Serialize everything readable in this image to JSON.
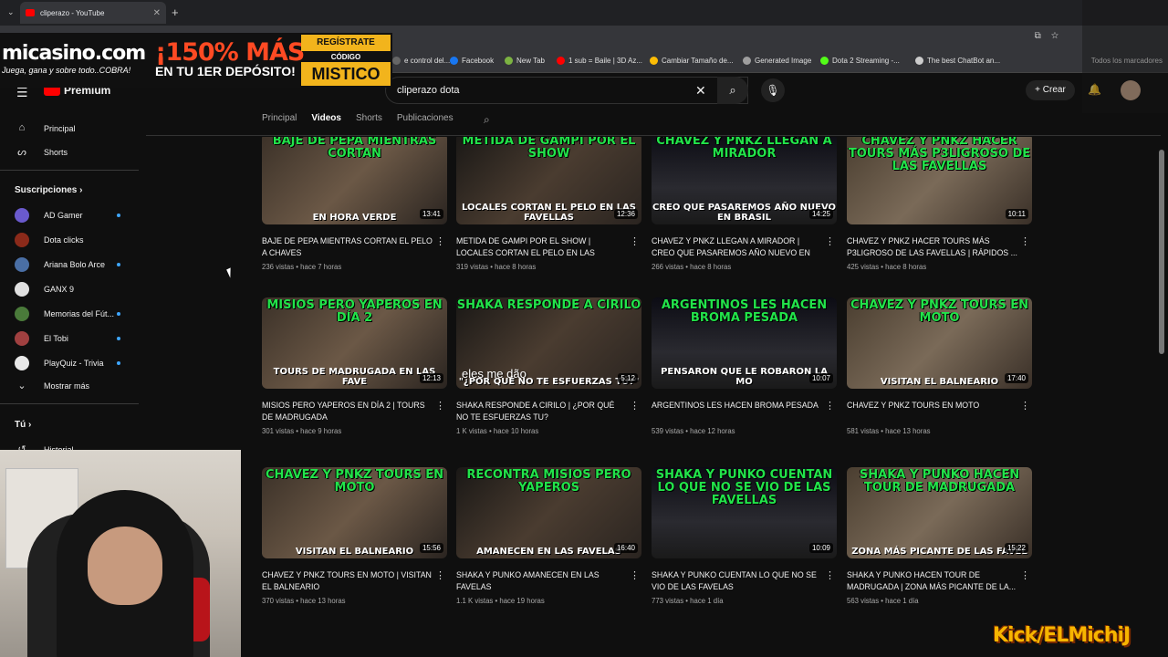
{
  "browser": {
    "tab_title": "cliperazo - YouTube",
    "bookmarks": [
      {
        "label": "e control del...",
        "color": "#666666"
      },
      {
        "label": "Facebook",
        "color": "#1877f2"
      },
      {
        "label": "New Tab",
        "color": "#7cb342"
      },
      {
        "label": "1 sub = Baile | 3D Az...",
        "color": "#ff0000"
      },
      {
        "label": "Cambiar Tamaño de...",
        "color": "#fbbc05"
      },
      {
        "label": "Generated Image",
        "color": "#9e9e9e"
      },
      {
        "label": "Dota 2 Streaming -...",
        "color": "#53fc18"
      },
      {
        "label": "The best ChatBot an...",
        "color": "#cccccc"
      }
    ],
    "bookmarks_right": "Todos los marcadores"
  },
  "ad": {
    "logo": "micasino.com",
    "slogan": "Juega, gana y sobre todo..COBRA!",
    "promo": "¡150% MÁS",
    "promo2": "EN TU 1ER DEPÓSITO!",
    "register": "REGÍSTRATE",
    "code_label": "CÓDIGO",
    "code": "MISTICO"
  },
  "youtube": {
    "logo": "Premium",
    "search_value": "cliperazo dota",
    "create_label": "Crear"
  },
  "sidebar": {
    "home": "Principal",
    "shorts": "Shorts",
    "subscriptions_header": "Suscripciones",
    "subscriptions": [
      {
        "label": "AD Gamer",
        "color": "#6a5acd",
        "new": true
      },
      {
        "label": "Dota clicks",
        "color": "#8b2a1a",
        "new": false
      },
      {
        "label": "Ariana Bolo Arce",
        "color": "#4a6fa5",
        "new": true
      },
      {
        "label": "GANX 9",
        "color": "#e0e0e0",
        "new": false
      },
      {
        "label": "Memorias del Fút...",
        "color": "#4a7a3a",
        "new": true
      },
      {
        "label": "El Tobi",
        "color": "#a04040",
        "new": true
      },
      {
        "label": "PlayQuiz - Trivia",
        "color": "#e8e8e8",
        "new": true
      }
    ],
    "show_more": "Mostrar más",
    "you_header": "Tú",
    "history": "Historial"
  },
  "channel_tabs": [
    "Principal",
    "Videos",
    "Shorts",
    "Publicaciones"
  ],
  "videos": [
    {
      "top_text": "BAJE DE PEPA MIENTRAS CORTAN",
      "bottom_text": "EN HORA VERDE",
      "duration": "13:41",
      "title": "BAJE DE PEPA MIENTRAS CORTAN EL PELO A CHAVES",
      "meta": "236 vistas • hace 7 horas"
    },
    {
      "top_text": "METIDA DE GAMPI POR EL SHOW",
      "bottom_text": "LOCALES CORTAN EL PELO EN LAS FAVELLAS",
      "duration": "12:36",
      "title": "METIDA DE GAMPI POR EL SHOW | LOCALES CORTAN EL PELO EN LAS FAVELAS",
      "meta": "319 vistas • hace 8 horas"
    },
    {
      "top_text": "CHAVEZ Y PNKZ LLEGAN A MIRADOR",
      "bottom_text": "CREO QUE PASAREMOS AÑO NUEVO EN BRASIL",
      "duration": "14:25",
      "title": "CHAVEZ Y PNKZ LLEGAN A MIRADOR | CREO QUE PASAREMOS AÑO NUEVO EN BRASIL",
      "meta": "266 vistas • hace 8 horas"
    },
    {
      "top_text": "CHAVEZ Y PNKZ HACER TOURS MÁS P3LIGROSO DE LAS FAVELLAS",
      "bottom_text": "",
      "duration": "10:11",
      "title": "CHAVEZ Y PNKZ HACER TOURS MÁS P3LIGROSO DE LAS FAVELLAS | RÁPIDOS ...",
      "meta": "425 vistas • hace 8 horas"
    },
    {
      "top_text": "MISIOS PERO YAPEROS EN DÍA 2",
      "bottom_text": "TOURS DE MADRUGADA EN LAS FAVE",
      "duration": "12:13",
      "title": "MISIOS PERO YAPEROS EN DÍA 2 | TOURS DE MADRUGADA",
      "meta": "301 vistas • hace 9 horas"
    },
    {
      "top_text": "SHAKA RESPONDE A CIRILO",
      "bottom_text": "\"¿POR QUÉ NO TE ESFUERZAS TU?\"",
      "duration": "5:12",
      "overlay": "eles me dão",
      "title": "SHAKA RESPONDE A CIRILO | ¿POR QUÉ NO TE ESFUERZAS TU?",
      "meta": "1 K vistas • hace 10 horas"
    },
    {
      "top_text": "ARGENTINOS LES HACEN BROMA PESADA",
      "bottom_text": "PENSARON QUE LE ROBARON LA MO",
      "duration": "10:07",
      "title": "ARGENTINOS LES HACEN BROMA PESADA",
      "meta": "539 vistas • hace 12 horas"
    },
    {
      "top_text": "CHAVEZ Y PNKZ TOURS EN MOTO",
      "bottom_text": "VISITAN EL BALNEARIO",
      "duration": "17:40",
      "title": "CHAVEZ Y PNKZ TOURS EN MOTO",
      "meta": "581 vistas • hace 13 horas"
    },
    {
      "top_text": "CHAVEZ Y PNKZ TOURS EN MOTO",
      "bottom_text": "VISITAN EL BALNEARIO",
      "duration": "15:56",
      "title": "CHAVEZ Y PNKZ TOURS EN MOTO | VISITAN EL BALNEARIO",
      "meta": "370 vistas • hace 13 horas"
    },
    {
      "top_text": "RECONTRA MISIOS PERO YAPEROS",
      "bottom_text": "AMANECEN EN LAS FAVELAS",
      "duration": "16:40",
      "title": "SHAKA Y PUNKO AMANECEN EN LAS FAVELAS",
      "meta": "1.1 K vistas • hace 19 horas"
    },
    {
      "top_text": "SHAKA Y PUNKO CUENTAN LO QUE NO SE VIO DE LAS FAVELLAS",
      "bottom_text": "",
      "duration": "10:09",
      "title": "SHAKA Y PUNKO CUENTAN LO QUE NO SE VIO DE LAS FAVELAS",
      "meta": "773 vistas • hace 1 día"
    },
    {
      "top_text": "SHAKA Y PUNKO HACEN TOUR DE MADRUGADA",
      "bottom_text": "ZONA MÁS PICANTE DE LAS FAVEL",
      "duration": "15:22",
      "title": "SHAKA Y PUNKO HACEN TOUR DE MADRUGADA | ZONA MÁS PICANTE DE LA...",
      "meta": "563 vistas • hace 1 día"
    }
  ],
  "overlay": {
    "kick": "Kick/ELMichiJ"
  }
}
